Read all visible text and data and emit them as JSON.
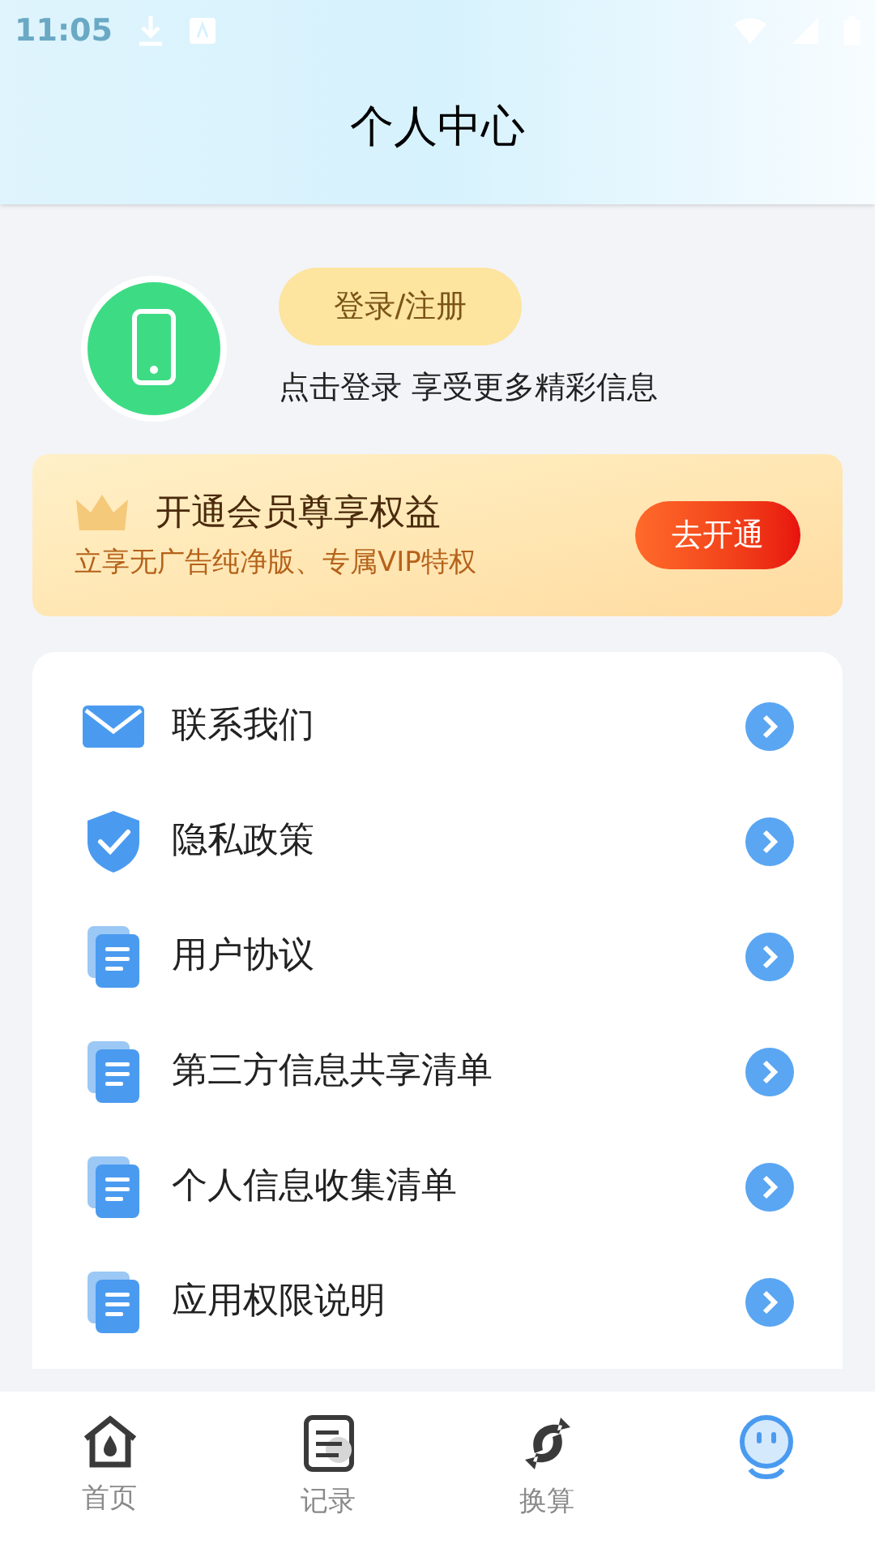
{
  "status_bar": {
    "time": "11:05"
  },
  "header": {
    "title": "个人中心"
  },
  "profile": {
    "login_button": "登录/注册",
    "hint": "点击登录 享受更多精彩信息"
  },
  "vip_card": {
    "title": "开通会员尊享权益",
    "subtitle": "立享无广告纯净版、专属VIP特权",
    "button": "去开通"
  },
  "menu": [
    {
      "kind": "mail",
      "label": "联系我们"
    },
    {
      "kind": "shield",
      "label": "隐私政策"
    },
    {
      "kind": "doc",
      "label": "用户协议"
    },
    {
      "kind": "doc",
      "label": "第三方信息共享清单"
    },
    {
      "kind": "doc",
      "label": "个人信息收集清单"
    },
    {
      "kind": "doc",
      "label": "应用权限说明"
    }
  ],
  "tabs": [
    {
      "kind": "home",
      "label": "首页",
      "selected": false
    },
    {
      "kind": "record",
      "label": "记录",
      "selected": false
    },
    {
      "kind": "convert",
      "label": "换算",
      "selected": false
    },
    {
      "kind": "mine",
      "selected": true
    }
  ]
}
